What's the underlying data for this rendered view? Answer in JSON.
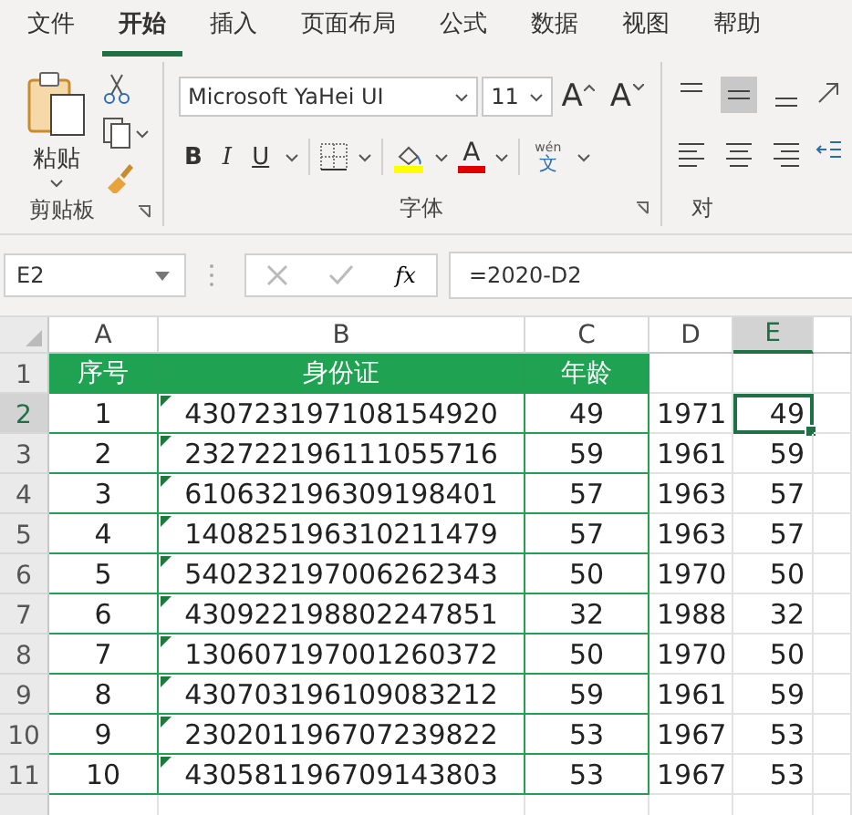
{
  "tabs": [
    {
      "label": "文件",
      "selected": false
    },
    {
      "label": "开始",
      "selected": true
    },
    {
      "label": "插入",
      "selected": false
    },
    {
      "label": "页面布局",
      "selected": false
    },
    {
      "label": "公式",
      "selected": false
    },
    {
      "label": "数据",
      "selected": false
    },
    {
      "label": "视图",
      "selected": false
    },
    {
      "label": "帮助",
      "selected": false
    }
  ],
  "ribbon": {
    "clipboard": {
      "paste_label": "粘贴",
      "group_label": "剪贴板"
    },
    "font": {
      "font_name": "Microsoft YaHei UI",
      "font_size": "11",
      "grow_label": "A",
      "shrink_label": "A",
      "bold_label": "B",
      "italic_label": "I",
      "underline_label": "U",
      "font_color_label": "A",
      "phonetic_top": "wén",
      "phonetic_bottom": "文",
      "group_label": "字体"
    },
    "alignment": {
      "group_label": "对"
    }
  },
  "formula_bar": {
    "name_box": "E2",
    "function_label": "fx",
    "formula": "=2020-D2"
  },
  "columns": [
    {
      "label": "A",
      "selected": false
    },
    {
      "label": "B",
      "selected": false
    },
    {
      "label": "C",
      "selected": false
    },
    {
      "label": "D",
      "selected": false
    },
    {
      "label": "E",
      "selected": true
    }
  ],
  "rows": [
    {
      "number": "1",
      "selected": false,
      "kind": "header",
      "cells": {
        "a": "序号",
        "b": "身份证",
        "c": "年龄"
      }
    },
    {
      "number": "2",
      "selected": true,
      "kind": "data",
      "text_flag": true,
      "cells": {
        "a": "1",
        "b": "430723197108154920",
        "c": "49",
        "d": "1971",
        "e": "49"
      }
    },
    {
      "number": "3",
      "selected": false,
      "kind": "data",
      "text_flag": true,
      "cells": {
        "a": "2",
        "b": "232722196111055716",
        "c": "59",
        "d": "1961",
        "e": "59"
      }
    },
    {
      "number": "4",
      "selected": false,
      "kind": "data",
      "text_flag": true,
      "cells": {
        "a": "3",
        "b": "610632196309198401",
        "c": "57",
        "d": "1963",
        "e": "57"
      }
    },
    {
      "number": "5",
      "selected": false,
      "kind": "data",
      "text_flag": true,
      "cells": {
        "a": "4",
        "b": "140825196310211479",
        "c": "57",
        "d": "1963",
        "e": "57"
      }
    },
    {
      "number": "6",
      "selected": false,
      "kind": "data",
      "text_flag": true,
      "cells": {
        "a": "5",
        "b": "540232197006262343",
        "c": "50",
        "d": "1970",
        "e": "50"
      }
    },
    {
      "number": "7",
      "selected": false,
      "kind": "data",
      "text_flag": true,
      "cells": {
        "a": "6",
        "b": "430922198802247851",
        "c": "32",
        "d": "1988",
        "e": "32"
      }
    },
    {
      "number": "8",
      "selected": false,
      "kind": "data",
      "text_flag": true,
      "cells": {
        "a": "7",
        "b": "130607197001260372",
        "c": "50",
        "d": "1970",
        "e": "50"
      }
    },
    {
      "number": "9",
      "selected": false,
      "kind": "data",
      "text_flag": true,
      "cells": {
        "a": "8",
        "b": "430703196109083212",
        "c": "59",
        "d": "1961",
        "e": "59"
      }
    },
    {
      "number": "10",
      "selected": false,
      "kind": "data",
      "text_flag": true,
      "cells": {
        "a": "9",
        "b": "230201196707239822",
        "c": "53",
        "d": "1967",
        "e": "53"
      }
    },
    {
      "number": "11",
      "selected": false,
      "kind": "data",
      "text_flag": true,
      "cells": {
        "a": "10",
        "b": "430581196709143803",
        "c": "53",
        "d": "1967",
        "e": "53"
      }
    }
  ]
}
